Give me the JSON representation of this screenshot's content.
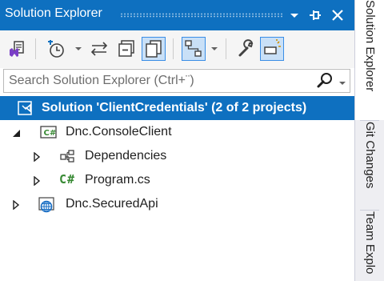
{
  "window": {
    "title": "Solution Explorer"
  },
  "search": {
    "placeholder": "Search Solution Explorer (Ctrl+¨)"
  },
  "tree": {
    "solution": {
      "label": "Solution 'ClientCredentials' (2 of 2 projects)",
      "icon": "solution-icon",
      "selected": true
    },
    "project1": {
      "label": "Dnc.ConsoleClient",
      "icon": "csharp-project-icon",
      "expanded": true
    },
    "dependencies": {
      "label": "Dependencies",
      "icon": "dependencies-icon",
      "expanded": false
    },
    "program": {
      "label": "Program.cs",
      "icon": "csharp-file-icon",
      "glyph": "C#",
      "expanded": false
    },
    "project2": {
      "label": "Dnc.SecuredApi",
      "icon": "web-project-icon",
      "expanded": false
    }
  },
  "side_tabs": [
    {
      "label": "Solution Explorer",
      "active": true
    },
    {
      "label": "Git Changes",
      "active": false
    },
    {
      "label": "Team Explo",
      "active": false
    }
  ],
  "toolbar": {
    "buttons": [
      "switch-views-icon",
      "history-icon",
      "sync-icon",
      "collapse-all-icon",
      "show-all-files-icon",
      "view-class-diagram-icon",
      "properties-icon",
      "preview-selected-icon"
    ]
  },
  "colors": {
    "accent": "#0e70c0",
    "selection_text": "#ffffff"
  }
}
